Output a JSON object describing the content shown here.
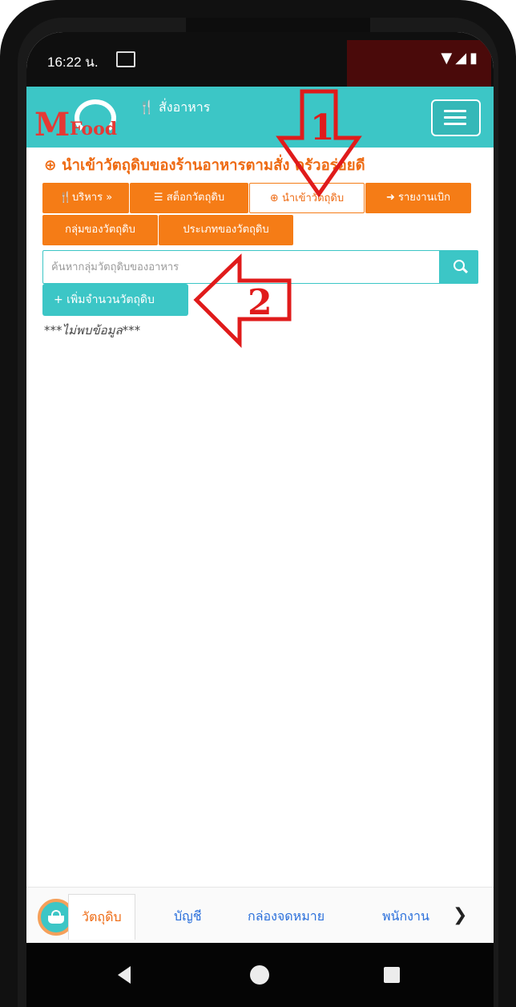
{
  "status_bar": {
    "time": "16:22 น.",
    "icons": [
      "gmail-icon",
      "wifi-icon",
      "signal-icon",
      "battery-icon"
    ]
  },
  "app": {
    "logo_m": "M",
    "logo_food": "Food",
    "header_title": "สั่งอาหาร",
    "accent_color": "#3cc6c6",
    "brand_orange": "#f57c16"
  },
  "page": {
    "title": "นำเข้าวัตถุดิบของร้านอาหารตามสั่ง ครัวอร่อยดี"
  },
  "nav": {
    "row1": [
      {
        "label": "บริหาร »",
        "icon": "utensils-icon",
        "active": false
      },
      {
        "label": "สต็อกวัตถุดิบ",
        "icon": "list-icon",
        "active": false
      },
      {
        "label": "นำเข้าวัตถุดิบ",
        "icon": "circle-arrow-icon",
        "active": true
      },
      {
        "label": "รายงานเบิก",
        "icon": "sign-out-icon",
        "active": false
      }
    ],
    "row2": [
      {
        "label": "กลุ่มของวัตถุดิบ"
      },
      {
        "label": "ประเภทของวัตถุดิบ"
      }
    ]
  },
  "search": {
    "placeholder": "ค้นหากลุ่มวัตถุดิบของอาหาร",
    "value": ""
  },
  "actions": {
    "add_label": "+ เพิ่มจำนวนวัตถุดิบ"
  },
  "content": {
    "empty_message": "***ไม่พบข้อมูล***"
  },
  "annotations": {
    "arrow1_number": "1",
    "arrow2_number": "2"
  },
  "bottom_tabs": [
    {
      "label": "วัตถุดิบ",
      "active": true
    },
    {
      "label": "บัญชี",
      "active": false
    },
    {
      "label": "กล่องจดหมาย",
      "active": false
    },
    {
      "label": "พนักงาน",
      "active": false
    }
  ]
}
